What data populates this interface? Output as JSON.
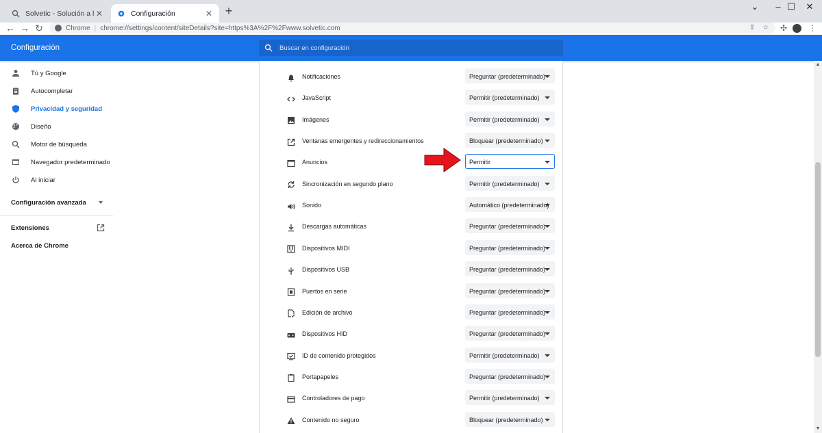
{
  "browser": {
    "tabs": [
      {
        "title": "Solvetic - Solución a los problem",
        "active": false,
        "icon": "search-favicon"
      },
      {
        "title": "Configuración",
        "active": true,
        "icon": "gear-favicon"
      }
    ],
    "new_tab": "+",
    "window_controls": {
      "minimize": "–",
      "maximize": "☐",
      "close": "✕"
    },
    "collapse": "⌄",
    "omnibox": {
      "site_label": "Chrome",
      "url": "chrome://settings/content/siteDetails?site=https%3A%2F%2Fwww.solvetic.com"
    }
  },
  "header": {
    "title": "Configuración",
    "search_placeholder": "Buscar en configuración"
  },
  "sidebar": {
    "items": [
      {
        "label": "Tú y Google",
        "icon": "person-icon"
      },
      {
        "label": "Autocompletar",
        "icon": "clipboard-icon"
      },
      {
        "label": "Privacidad y seguridad",
        "icon": "shield-icon",
        "active": true
      },
      {
        "label": "Diseño",
        "icon": "palette-icon"
      },
      {
        "label": "Motor de búsqueda",
        "icon": "search-icon"
      },
      {
        "label": "Navegador predeterminado",
        "icon": "browser-icon"
      },
      {
        "label": "Al iniciar",
        "icon": "power-icon"
      }
    ],
    "advanced": "Configuración avanzada",
    "extensions": "Extensiones",
    "about": "Acerca de Chrome"
  },
  "permissions": [
    {
      "label": "Notificaciones",
      "value": "Preguntar (predeterminado)",
      "icon": "bell-icon"
    },
    {
      "label": "JavaScript",
      "value": "Permitir (predeterminado)",
      "icon": "code-icon"
    },
    {
      "label": "Imágenes",
      "value": "Permitir (predeterminado)",
      "icon": "image-icon"
    },
    {
      "label": "Ventanas emergentes y redireccionamientos",
      "value": "Bloquear (predeterminado)",
      "icon": "open-in-new-icon"
    },
    {
      "label": "Anuncios",
      "value": "Permitir",
      "icon": "ads-window-icon",
      "focused": true
    },
    {
      "label": "Sincronización en segundo plano",
      "value": "Permitir (predeterminado)",
      "icon": "sync-icon"
    },
    {
      "label": "Sonido",
      "value": "Automático (predeterminado)",
      "icon": "volume-icon"
    },
    {
      "label": "Descargas automáticas",
      "value": "Preguntar (predeterminado)",
      "icon": "download-icon"
    },
    {
      "label": "Dispositivos MIDI",
      "value": "Preguntar (predeterminado)",
      "icon": "piano-icon"
    },
    {
      "label": "Dispositivos USB",
      "value": "Preguntar (predeterminado)",
      "icon": "usb-icon"
    },
    {
      "label": "Puertos en serie",
      "value": "Preguntar (predeterminado)",
      "icon": "serial-port-icon"
    },
    {
      "label": "Edición de archivo",
      "value": "Preguntar (predeterminado)",
      "icon": "file-edit-icon"
    },
    {
      "label": "Dispositivos HID",
      "value": "Preguntar (predeterminado)",
      "icon": "gamepad-icon"
    },
    {
      "label": "ID de contenido protegidos",
      "value": "Permitir (predeterminado)",
      "icon": "protected-content-icon"
    },
    {
      "label": "Portapapeles",
      "value": "Preguntar (predeterminado)",
      "icon": "clipboard-icon"
    },
    {
      "label": "Controladores de pago",
      "value": "Permitir (predeterminado)",
      "icon": "credit-card-icon"
    },
    {
      "label": "Contenido no seguro",
      "value": "Bloquear (predeterminado)",
      "icon": "warning-icon"
    }
  ],
  "colors": {
    "accent": "#1a73e8",
    "annotation_arrow": "#e8141b"
  }
}
